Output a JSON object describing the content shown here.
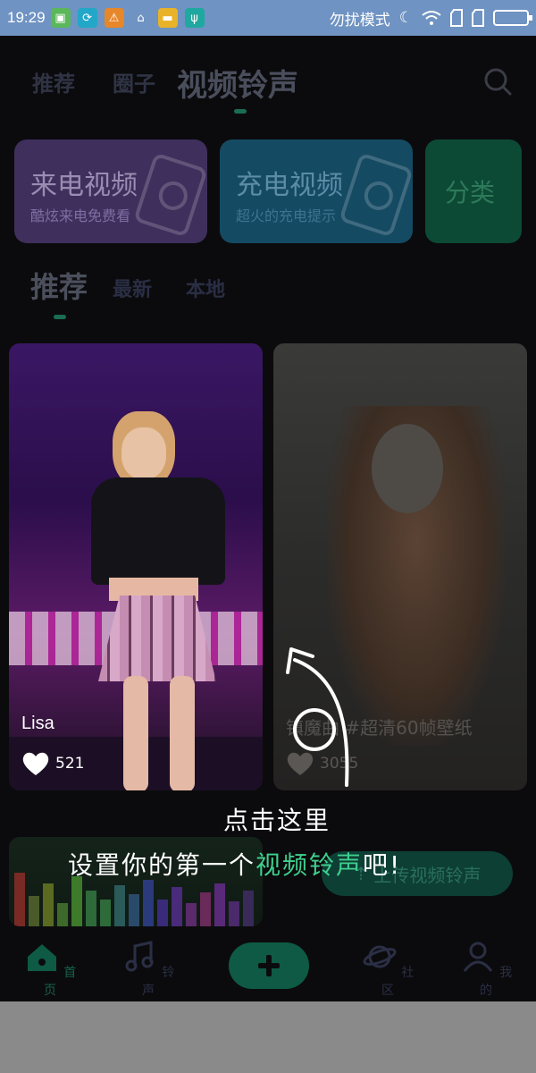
{
  "status_bar": {
    "time": "19:29",
    "mode_text": "勿扰模式"
  },
  "top_nav": {
    "tabs": [
      "推荐",
      "圈子",
      "视频铃声"
    ],
    "active_tab": "视频铃声"
  },
  "feature_cards": [
    {
      "title": "来电视频",
      "subtitle": "酷炫来电免费看"
    },
    {
      "title": "充电视频",
      "subtitle": "超火的充电提示"
    },
    {
      "title": "分类",
      "subtitle": ""
    }
  ],
  "sub_tabs": [
    "推荐",
    "最新",
    "本地"
  ],
  "videos": [
    {
      "name": "Lisa",
      "likes": "521"
    },
    {
      "name": "镇魔曲 #超清60帧壁纸",
      "likes": "3055"
    }
  ],
  "upload_button": {
    "label": "上传视频铃声"
  },
  "bottom_nav": [
    {
      "label": "首页",
      "icon": "home-icon"
    },
    {
      "label": "铃声",
      "icon": "music-icon"
    },
    {
      "label": "",
      "icon": "plus-icon"
    },
    {
      "label": "社区",
      "icon": "planet-icon"
    },
    {
      "label": "我的",
      "icon": "user-icon"
    }
  ],
  "guide": {
    "line1": "点击这里",
    "line2_prefix": "设置你的第一个",
    "line2_highlight": "视频铃声",
    "line2_suffix": "吧!"
  },
  "colors": {
    "status_bar_bg": "#6f93c2",
    "app_bg": "#0b0b0d",
    "accent_green": "#3fd08e"
  }
}
